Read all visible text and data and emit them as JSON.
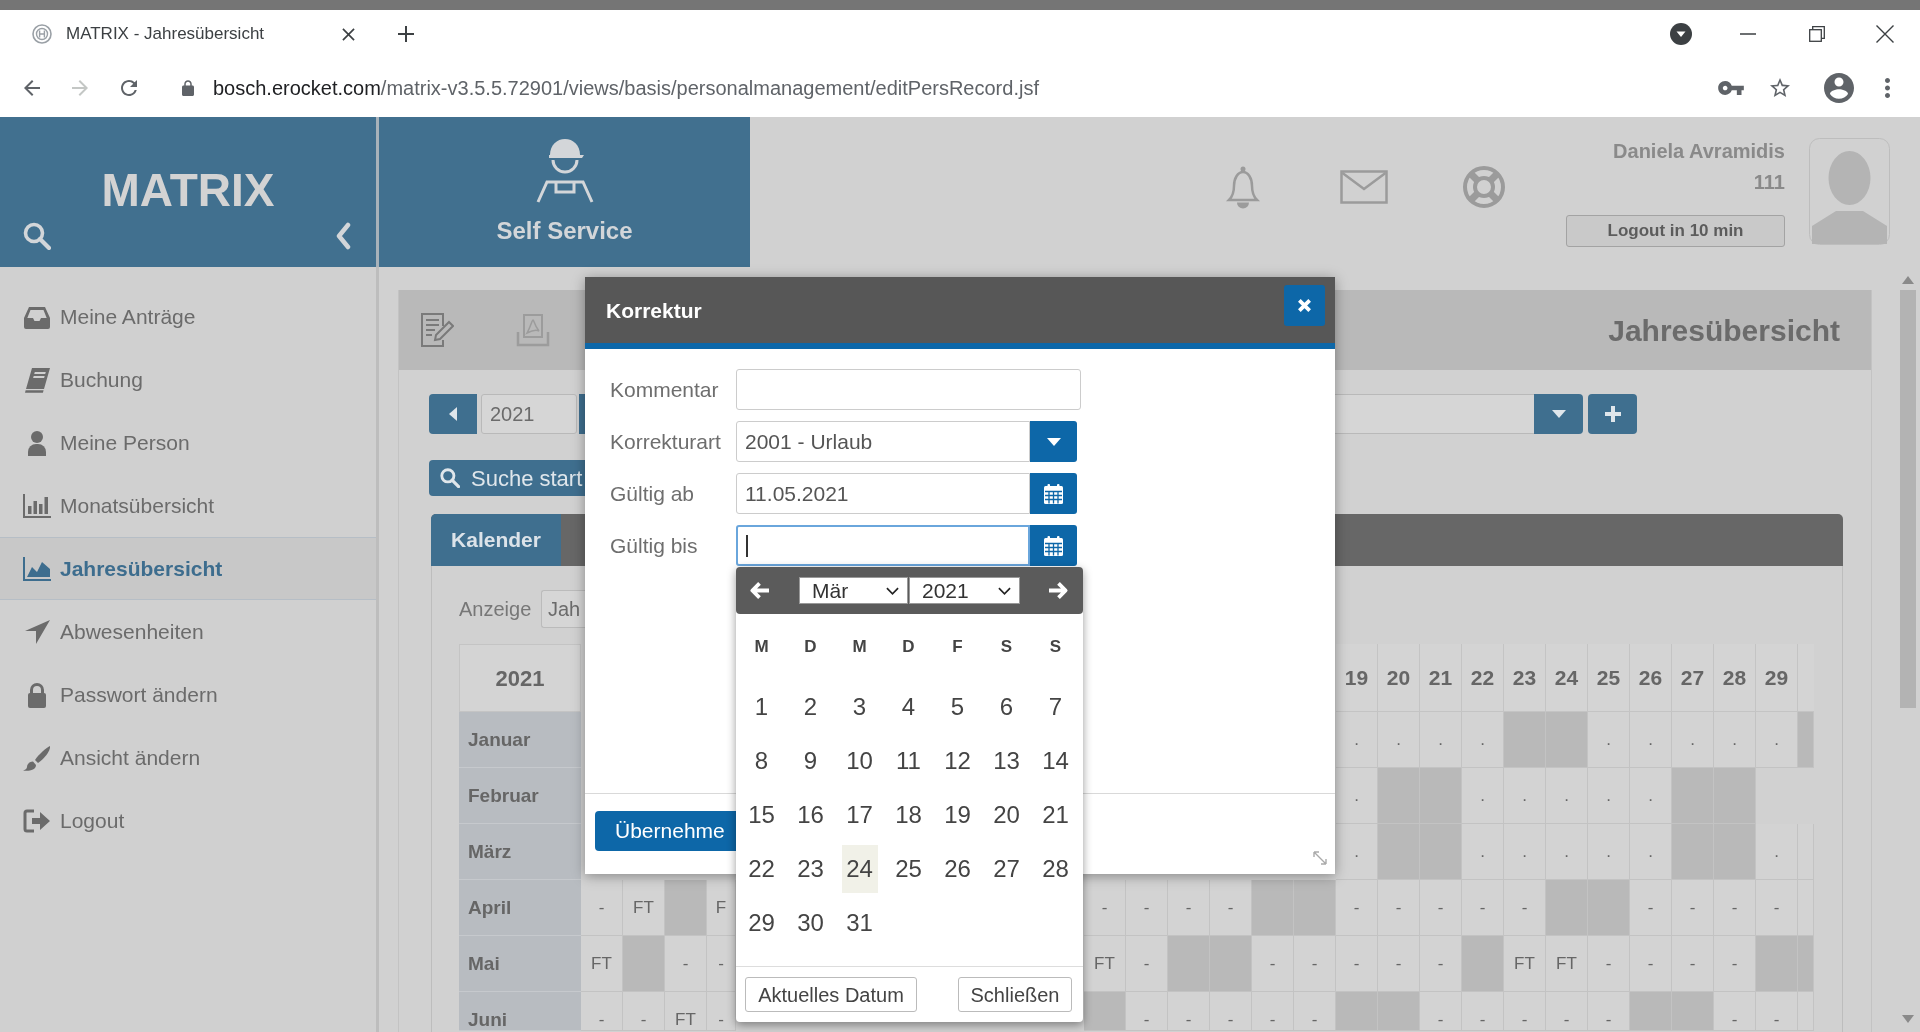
{
  "browser": {
    "tab_title": "MATRIX - Jahresübersicht",
    "url_host": "bosch.erocket.com",
    "url_path": "/matrix-v3.5.5.72901/views/basis/personalmanagement/editPersRecord.jsf"
  },
  "header": {
    "logo": "MATRIX",
    "module": "Self Service",
    "user_name": "Daniela Avramidis",
    "user_number": "111",
    "logout_button": "Logout in 10 min"
  },
  "sidebar": {
    "items": [
      {
        "label": "Meine Anträge",
        "selected": false
      },
      {
        "label": "Buchung",
        "selected": false
      },
      {
        "label": "Meine Person",
        "selected": false
      },
      {
        "label": "Monatsübersicht",
        "selected": false
      },
      {
        "label": "Jahresübersicht",
        "selected": true
      },
      {
        "label": "Abwesenheiten",
        "selected": false
      },
      {
        "label": "Passwort ändern",
        "selected": false
      },
      {
        "label": "Ansicht ändern",
        "selected": false
      },
      {
        "label": "Logout",
        "selected": false
      }
    ]
  },
  "panel": {
    "title": "Jahresübersicht",
    "year_field": "2021",
    "search_button": "Suche start",
    "tabs": [
      {
        "label": "Kalender",
        "selected": true
      }
    ],
    "display_label": "Anzeige",
    "display_select": "Jah",
    "year_table": {
      "corner": "2021",
      "day_headers": [
        "19",
        "20",
        "21",
        "22",
        "23",
        "24",
        "25",
        "26",
        "27",
        "28",
        "29"
      ],
      "rows": [
        {
          "month": "Januar",
          "cells": [
            "",
            "",
            "",
            "",
            "",
            "",
            "",
            "",
            "",
            "",
            {
              "text": ".",
              "shaded": false
            },
            {
              "text": ".",
              "shaded": false
            },
            {
              "text": ".",
              "shaded": false
            },
            {
              "text": ".",
              "shaded": false
            },
            {
              "shaded": true
            },
            {
              "shaded": true
            },
            {
              "text": ".",
              "shaded": false
            },
            {
              "text": ".",
              "shaded": false
            },
            {
              "text": ".",
              "shaded": false
            },
            {
              "text": ".",
              "shaded": false
            },
            {
              "text": ".",
              "shaded": false
            },
            {
              "shaded": true
            }
          ]
        },
        {
          "month": "Februar",
          "cells": [
            "",
            "",
            "",
            "",
            "",
            "",
            "",
            "",
            "",
            "",
            {
              "text": ".",
              "shaded": false
            },
            {
              "shaded": true
            },
            {
              "shaded": true
            },
            {
              "text": ".",
              "shaded": false
            },
            {
              "text": ".",
              "shaded": false
            },
            {
              "text": ".",
              "shaded": false
            },
            {
              "text": ".",
              "shaded": false
            },
            {
              "text": ".",
              "shaded": false
            },
            {
              "shaded": true
            },
            {
              "shaded": true
            }
          ]
        },
        {
          "month": "März",
          "cells": [
            "",
            "",
            "",
            "",
            "",
            "",
            "",
            "",
            "",
            "",
            {
              "text": ".",
              "shaded": false
            },
            {
              "shaded": true
            },
            {
              "shaded": true
            },
            {
              "text": ".",
              "shaded": false
            },
            {
              "text": ".",
              "shaded": false
            },
            {
              "text": ".",
              "shaded": false
            },
            {
              "text": ".",
              "shaded": false
            },
            {
              "text": ".",
              "shaded": false
            },
            {
              "shaded": true
            },
            {
              "shaded": true
            },
            {
              "text": ".",
              "shaded": false
            },
            {
              "shaded": false
            }
          ]
        },
        {
          "month": "April",
          "cells": [
            {
              "text": "-",
              "shaded": false
            },
            {
              "text": "FT",
              "shaded": false
            },
            {
              "shaded": true
            },
            {
              "text": "F",
              "shaded": false
            },
            {
              "text": "-",
              "shaded": false
            },
            {
              "text": "-",
              "shaded": false
            },
            {
              "text": "-",
              "shaded": false
            },
            {
              "text": "-",
              "shaded": false
            },
            {
              "shaded": true
            },
            {
              "shaded": true
            },
            {
              "text": "-",
              "shaded": false
            },
            {
              "text": "-",
              "shaded": false
            },
            {
              "text": "-",
              "shaded": false
            },
            {
              "text": "-",
              "shaded": false
            },
            {
              "text": "-",
              "shaded": false
            },
            {
              "shaded": true
            },
            {
              "shaded": true
            },
            {
              "text": "-",
              "shaded": false
            },
            {
              "text": "-",
              "shaded": false
            },
            {
              "text": "-",
              "shaded": false
            },
            {
              "text": "-",
              "shaded": false
            },
            {
              "shaded": false
            }
          ]
        },
        {
          "month": "Mai",
          "cells": [
            {
              "text": "FT",
              "shaded": false
            },
            {
              "shaded": true
            },
            {
              "text": "-",
              "shaded": false
            },
            {
              "text": "-",
              "shaded": false
            },
            {
              "text": "FT",
              "shaded": false
            },
            {
              "text": "-",
              "shaded": false
            },
            {
              "shaded": true
            },
            {
              "shaded": true
            },
            {
              "text": "-",
              "shaded": false
            },
            {
              "text": "-",
              "shaded": false
            },
            {
              "text": "-",
              "shaded": false
            },
            {
              "text": "-",
              "shaded": false
            },
            {
              "text": "-",
              "shaded": false
            },
            {
              "shaded": true
            },
            {
              "text": "FT",
              "shaded": false
            },
            {
              "text": "FT",
              "shaded": false
            },
            {
              "text": "-",
              "shaded": false
            },
            {
              "text": "-",
              "shaded": false
            },
            {
              "text": "-",
              "shaded": false
            },
            {
              "text": "-",
              "shaded": false
            },
            {
              "shaded": true
            },
            {
              "shaded": true
            }
          ]
        },
        {
          "month": "Juni",
          "cells": [
            {
              "text": "-",
              "shaded": false
            },
            {
              "text": "-",
              "shaded": false
            },
            {
              "text": "FT",
              "shaded": false
            },
            {
              "text": "-",
              "shaded": false
            },
            {
              "shaded": true
            },
            {
              "text": "-",
              "shaded": false
            },
            {
              "text": "-",
              "shaded": false
            },
            {
              "text": "-",
              "shaded": false
            },
            {
              "text": "-",
              "shaded": false
            },
            {
              "text": "-",
              "shaded": false
            },
            {
              "shaded": true
            },
            {
              "shaded": true
            },
            {
              "text": "-",
              "shaded": false
            },
            {
              "text": "-",
              "shaded": false
            },
            {
              "text": "-",
              "shaded": false
            },
            {
              "text": "-",
              "shaded": false
            },
            {
              "text": "-",
              "shaded": false
            },
            {
              "shaded": true
            },
            {
              "shaded": true
            },
            {
              "text": "-",
              "shaded": false
            },
            {
              "text": "-",
              "shaded": false
            },
            {
              "shaded": false
            }
          ]
        }
      ]
    }
  },
  "dialog": {
    "title": "Korrektur",
    "fields": [
      {
        "kind": "text",
        "label": "Kommentar",
        "focused": false
      },
      {
        "kind": "select",
        "label": "Korrekturart",
        "value": "2001 - Urlaub",
        "focused": false
      },
      {
        "kind": "date",
        "label": "Gültig ab",
        "value": "11.05.2021",
        "focused": false
      },
      {
        "kind": "date",
        "label": "Gültig bis",
        "focused": true
      }
    ],
    "apply_button": "Übernehme"
  },
  "datepicker": {
    "month": "Mär",
    "year": "2021",
    "weekdays": [
      "M",
      "D",
      "M",
      "D",
      "F",
      "S",
      "S"
    ],
    "days": [
      {
        "label": "1",
        "today": false
      },
      {
        "label": "2",
        "today": false
      },
      {
        "label": "3",
        "today": false
      },
      {
        "label": "4",
        "today": false
      },
      {
        "label": "5",
        "today": false
      },
      {
        "label": "6",
        "today": false
      },
      {
        "label": "7",
        "today": false
      },
      {
        "label": "8",
        "today": false
      },
      {
        "label": "9",
        "today": false
      },
      {
        "label": "10",
        "today": false
      },
      {
        "label": "11",
        "today": false
      },
      {
        "label": "12",
        "today": false
      },
      {
        "label": "13",
        "today": false
      },
      {
        "label": "14",
        "today": false
      },
      {
        "label": "15",
        "today": false
      },
      {
        "label": "16",
        "today": false
      },
      {
        "label": "17",
        "today": false
      },
      {
        "label": "18",
        "today": false
      },
      {
        "label": "19",
        "today": false
      },
      {
        "label": "20",
        "today": false
      },
      {
        "label": "21",
        "today": false
      },
      {
        "label": "22",
        "today": false
      },
      {
        "label": "23",
        "today": false
      },
      {
        "label": "24",
        "today": true
      },
      {
        "label": "25",
        "today": false
      },
      {
        "label": "26",
        "today": false
      },
      {
        "label": "27",
        "today": false
      },
      {
        "label": "28",
        "today": false
      },
      {
        "label": "29",
        "today": false
      },
      {
        "label": "30",
        "today": false
      },
      {
        "label": "31",
        "today": false
      }
    ],
    "today_button": "Aktuelles Datum",
    "close_button": "Schließen"
  }
}
